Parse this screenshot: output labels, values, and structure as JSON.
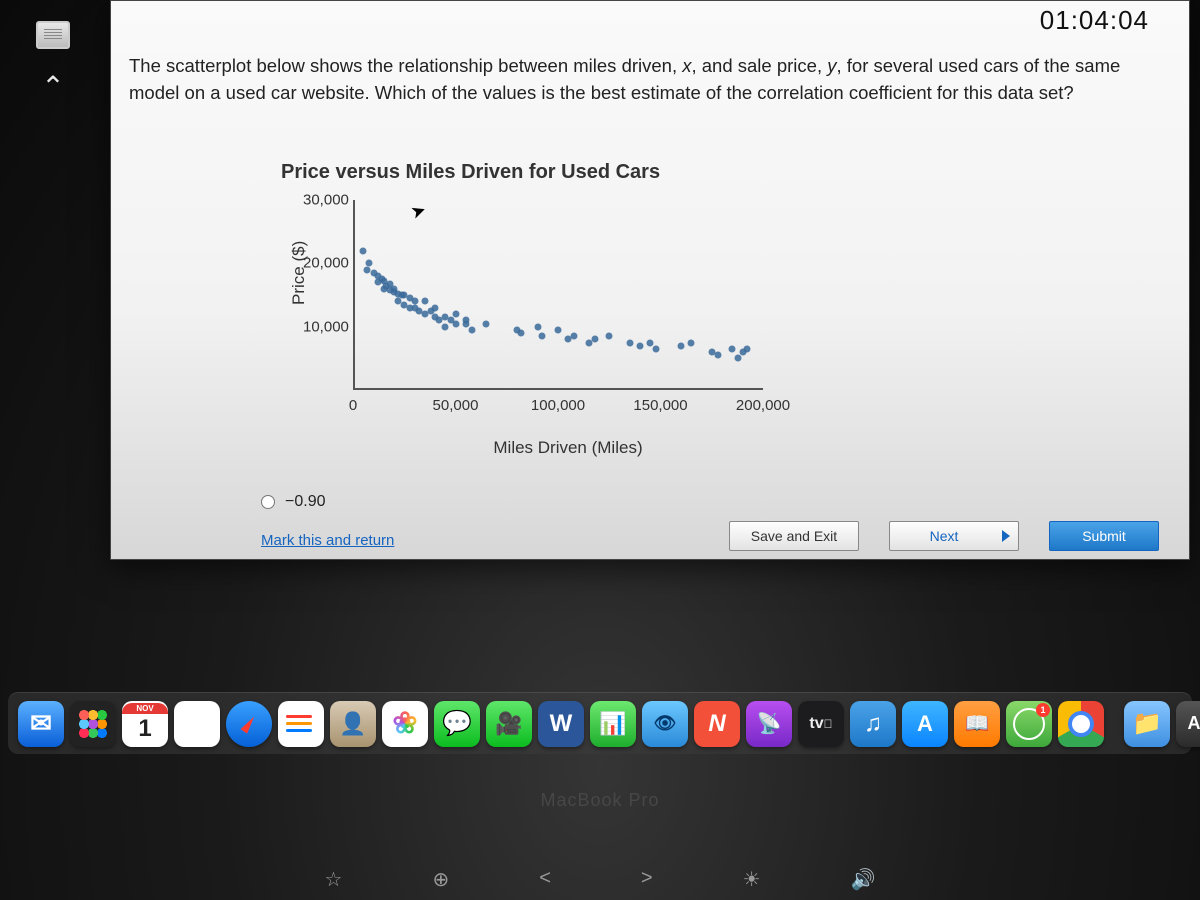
{
  "timer": "01:04:04",
  "question": {
    "text_a": "The scatterplot below shows the relationship between miles driven, ",
    "var_x": "x",
    "text_b": ", and sale price, ",
    "var_y": "y",
    "text_c": ", for several used cars of the same model on a used car website. Which of the values is the best estimate of the correlation coefficient for this data set?"
  },
  "answers": {
    "opt_a": "−0.90"
  },
  "actions": {
    "mark": "Mark this and return",
    "save": "Save and Exit",
    "next": "Next",
    "submit": "Submit"
  },
  "dock": {
    "calendar": {
      "month": "NOV",
      "day": "1"
    },
    "time_badge": "1",
    "tv_prefix": ""
  },
  "laptop": "MacBook Pro",
  "fn_icons": [
    "☆",
    "⊕",
    "<",
    ">",
    "☀",
    "🔊"
  ],
  "chart_data": {
    "type": "scatter",
    "title": "Price versus Miles Driven for Used Cars",
    "xlabel": "Miles Driven (Miles)",
    "ylabel": "Price ($)",
    "xlim": [
      0,
      200000
    ],
    "ylim": [
      0,
      30000
    ],
    "x_ticks": [
      0,
      50000,
      100000,
      150000,
      200000
    ],
    "x_tick_labels": [
      "0",
      "50,000",
      "100,000",
      "150,000",
      "200,000"
    ],
    "y_ticks": [
      10000,
      20000,
      30000
    ],
    "y_tick_labels": [
      "10,000",
      "20,000",
      "30,000"
    ],
    "points": [
      [
        5000,
        22000
      ],
      [
        7000,
        19000
      ],
      [
        8000,
        20000
      ],
      [
        10000,
        18500
      ],
      [
        12000,
        18000
      ],
      [
        12000,
        17000
      ],
      [
        14000,
        17500
      ],
      [
        15000,
        17200
      ],
      [
        15000,
        16000
      ],
      [
        16000,
        16500
      ],
      [
        18000,
        16800
      ],
      [
        18000,
        15800
      ],
      [
        20000,
        16000
      ],
      [
        20000,
        15500
      ],
      [
        22000,
        15200
      ],
      [
        22000,
        14000
      ],
      [
        24000,
        15000
      ],
      [
        25000,
        15000
      ],
      [
        25000,
        13500
      ],
      [
        28000,
        14500
      ],
      [
        28000,
        13000
      ],
      [
        30000,
        14000
      ],
      [
        30000,
        13000
      ],
      [
        32000,
        12500
      ],
      [
        35000,
        14000
      ],
      [
        35000,
        12000
      ],
      [
        38000,
        12500
      ],
      [
        40000,
        13000
      ],
      [
        40000,
        11500
      ],
      [
        42000,
        11000
      ],
      [
        45000,
        11500
      ],
      [
        45000,
        10000
      ],
      [
        48000,
        11000
      ],
      [
        50000,
        12000
      ],
      [
        50000,
        10500
      ],
      [
        55000,
        11000
      ],
      [
        55000,
        10500
      ],
      [
        58000,
        9500
      ],
      [
        65000,
        10500
      ],
      [
        80000,
        9500
      ],
      [
        82000,
        9000
      ],
      [
        90000,
        10000
      ],
      [
        92000,
        8500
      ],
      [
        100000,
        9500
      ],
      [
        105000,
        8000
      ],
      [
        108000,
        8500
      ],
      [
        115000,
        7500
      ],
      [
        118000,
        8000
      ],
      [
        125000,
        8500
      ],
      [
        135000,
        7500
      ],
      [
        140000,
        7000
      ],
      [
        145000,
        7500
      ],
      [
        148000,
        6500
      ],
      [
        160000,
        7000
      ],
      [
        165000,
        7500
      ],
      [
        175000,
        6000
      ],
      [
        178000,
        5500
      ],
      [
        185000,
        6500
      ],
      [
        188000,
        5000
      ],
      [
        190000,
        6000
      ],
      [
        192000,
        6500
      ]
    ]
  }
}
